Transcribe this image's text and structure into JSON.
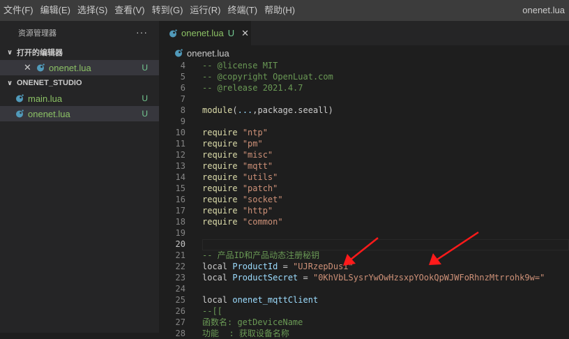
{
  "menu": {
    "items": [
      "文件(F)",
      "编辑(E)",
      "选择(S)",
      "查看(V)",
      "转到(G)",
      "运行(R)",
      "终端(T)",
      "帮助(H)"
    ],
    "window_title": "onenet.lua"
  },
  "sidebar": {
    "header": "资源管理器",
    "more": "···",
    "open_editors": {
      "title": "打开的编辑器",
      "items": [
        {
          "close": "✕",
          "label": "onenet.lua",
          "status": "U"
        }
      ]
    },
    "project": {
      "title": "ONENET_STUDIO",
      "items": [
        {
          "label": "main.lua",
          "status": "U"
        },
        {
          "label": "onenet.lua",
          "status": "U"
        }
      ]
    }
  },
  "editor": {
    "tab": {
      "label": "onenet.lua",
      "status": "U",
      "close": "✕"
    },
    "breadcrumb": "onenet.lua",
    "current_line": 20,
    "lines": [
      {
        "n": "4",
        "segments": [
          {
            "c": "com",
            "t": "-- @license MIT"
          }
        ]
      },
      {
        "n": "5",
        "segments": [
          {
            "c": "com",
            "t": "-- @copyright OpenLuat.com"
          }
        ]
      },
      {
        "n": "6",
        "segments": [
          {
            "c": "com",
            "t": "-- @release 2021.4.7"
          }
        ]
      },
      {
        "n": "7",
        "segments": []
      },
      {
        "n": "8",
        "segments": [
          {
            "c": "id",
            "t": "module"
          },
          {
            "c": "kw",
            "t": "("
          },
          {
            "c": "var",
            "t": "..."
          },
          {
            "c": "kw",
            "t": ",package.seeall)"
          }
        ]
      },
      {
        "n": "9",
        "segments": []
      },
      {
        "n": "10",
        "segments": [
          {
            "c": "id",
            "t": "require"
          },
          {
            "c": "kw",
            "t": " "
          },
          {
            "c": "str",
            "t": "\"ntp\""
          }
        ]
      },
      {
        "n": "11",
        "segments": [
          {
            "c": "id",
            "t": "require"
          },
          {
            "c": "kw",
            "t": " "
          },
          {
            "c": "str",
            "t": "\"pm\""
          }
        ]
      },
      {
        "n": "12",
        "segments": [
          {
            "c": "id",
            "t": "require"
          },
          {
            "c": "kw",
            "t": " "
          },
          {
            "c": "str",
            "t": "\"misc\""
          }
        ]
      },
      {
        "n": "13",
        "segments": [
          {
            "c": "id",
            "t": "require"
          },
          {
            "c": "kw",
            "t": " "
          },
          {
            "c": "str",
            "t": "\"mqtt\""
          }
        ]
      },
      {
        "n": "14",
        "segments": [
          {
            "c": "id",
            "t": "require"
          },
          {
            "c": "kw",
            "t": " "
          },
          {
            "c": "str",
            "t": "\"utils\""
          }
        ]
      },
      {
        "n": "15",
        "segments": [
          {
            "c": "id",
            "t": "require"
          },
          {
            "c": "kw",
            "t": " "
          },
          {
            "c": "str",
            "t": "\"patch\""
          }
        ]
      },
      {
        "n": "16",
        "segments": [
          {
            "c": "id",
            "t": "require"
          },
          {
            "c": "kw",
            "t": " "
          },
          {
            "c": "str",
            "t": "\"socket\""
          }
        ]
      },
      {
        "n": "17",
        "segments": [
          {
            "c": "id",
            "t": "require"
          },
          {
            "c": "kw",
            "t": " "
          },
          {
            "c": "str",
            "t": "\"http\""
          }
        ]
      },
      {
        "n": "18",
        "segments": [
          {
            "c": "id",
            "t": "require"
          },
          {
            "c": "kw",
            "t": " "
          },
          {
            "c": "str",
            "t": "\"common\""
          }
        ]
      },
      {
        "n": "19",
        "segments": []
      },
      {
        "n": "20",
        "segments": []
      },
      {
        "n": "21",
        "segments": [
          {
            "c": "com",
            "t": "-- 产品ID和产品动态注册秘钥"
          }
        ]
      },
      {
        "n": "22",
        "segments": [
          {
            "c": "kw",
            "t": "local "
          },
          {
            "c": "var",
            "t": "ProductId"
          },
          {
            "c": "kw",
            "t": " = "
          },
          {
            "c": "str",
            "t": "\"UJRzepDusi\""
          }
        ]
      },
      {
        "n": "23",
        "segments": [
          {
            "c": "kw",
            "t": "local "
          },
          {
            "c": "var",
            "t": "ProductSecret"
          },
          {
            "c": "kw",
            "t": " = "
          },
          {
            "c": "str",
            "t": "\"0KhVbLSysrYwOwHzsxpYOokQpWJWFoRhnzMtrrohk9w=\""
          }
        ]
      },
      {
        "n": "24",
        "segments": []
      },
      {
        "n": "25",
        "segments": [
          {
            "c": "kw",
            "t": "local "
          },
          {
            "c": "var",
            "t": "onenet_mqttClient"
          }
        ]
      },
      {
        "n": "26",
        "segments": [
          {
            "c": "com",
            "t": "--[["
          }
        ]
      },
      {
        "n": "27",
        "segments": [
          {
            "c": "com",
            "t": "函数名: getDeviceName"
          }
        ]
      },
      {
        "n": "28",
        "segments": [
          {
            "c": "com",
            "t": "功能  : 获取设备名称"
          }
        ]
      }
    ]
  },
  "colors": {
    "arrow": "#ff1a1a",
    "accent_green": "#8cc265",
    "status_u": "#73c991"
  }
}
